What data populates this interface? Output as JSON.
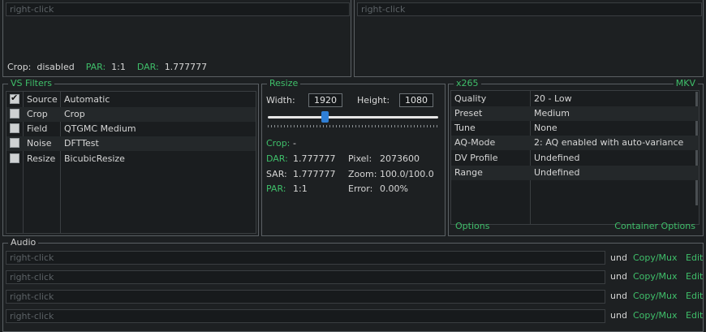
{
  "top_left": {
    "placeholder": "right-click",
    "crop_label": "Crop:",
    "crop_value": "disabled",
    "par_label": "PAR:",
    "par_value": "1:1",
    "dar_label": "DAR:",
    "dar_value": "1.777777"
  },
  "top_right": {
    "placeholder": "right-click"
  },
  "vs_filters": {
    "title": "VS Filters",
    "rows": [
      {
        "checked": true,
        "name": "Source",
        "value": "Automatic"
      },
      {
        "checked": false,
        "name": "Crop",
        "value": "Crop"
      },
      {
        "checked": false,
        "name": "Field",
        "value": "QTGMC Medium"
      },
      {
        "checked": false,
        "name": "Noise",
        "value": "DFTTest"
      },
      {
        "checked": false,
        "name": "Resize",
        "value": "BicubicResize"
      }
    ]
  },
  "resize": {
    "title": "Resize",
    "width_label": "Width:",
    "width_value": "1920",
    "height_label": "Height:",
    "height_value": "1080",
    "slider_fraction": 0.33,
    "crop_label": "Crop:",
    "crop_value": "-",
    "dar_label": "DAR:",
    "dar_value": "1.777777",
    "pixel_label": "Pixel:",
    "pixel_value": "2073600",
    "sar_label": "SAR:",
    "sar_value": "1.777777",
    "zoom_label": "Zoom:",
    "zoom_value": "100.0/100.0",
    "par_label": "PAR:",
    "par_value": "1:1",
    "error_label": "Error:",
    "error_value": "0.00%"
  },
  "encoder": {
    "title": "x265",
    "container": "MKV",
    "rows": [
      {
        "key": "Quality",
        "value": "20 - Low"
      },
      {
        "key": "Preset",
        "value": "Medium"
      },
      {
        "key": "Tune",
        "value": "None"
      },
      {
        "key": "AQ-Mode",
        "value": "2: AQ enabled with auto-variance"
      },
      {
        "key": "DV Profile",
        "value": "Undefined"
      },
      {
        "key": "Range",
        "value": "Undefined"
      }
    ],
    "options_link": "Options",
    "container_options_link": "Container Options"
  },
  "audio": {
    "title": "Audio",
    "tracks": [
      {
        "placeholder": "right-click",
        "lang": "und",
        "action": "Copy/Mux",
        "edit": "Edit"
      },
      {
        "placeholder": "right-click",
        "lang": "und",
        "action": "Copy/Mux",
        "edit": "Edit"
      },
      {
        "placeholder": "right-click",
        "lang": "und",
        "action": "Copy/Mux",
        "edit": "Edit"
      },
      {
        "placeholder": "right-click",
        "lang": "und",
        "action": "Copy/Mux",
        "edit": "Edit"
      }
    ]
  },
  "colors": {
    "accent": "#3fbf6a",
    "background": "#1d2022",
    "slider_handle": "#2f7fd6"
  }
}
